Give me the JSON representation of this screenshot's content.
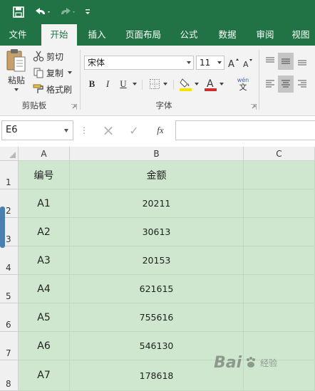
{
  "colors": {
    "accent": "#217346",
    "selection_fill": "#cfe7cf",
    "font_color_bar": "#d42b2b",
    "fill_color_bar": "#f5e400"
  },
  "qat": {
    "icons": [
      "save-icon",
      "undo-icon",
      "redo-icon",
      "customize-qat-icon"
    ]
  },
  "tabs": [
    {
      "label": "文件",
      "active": false
    },
    {
      "label": "开始",
      "active": true
    },
    {
      "label": "插入",
      "active": false
    },
    {
      "label": "页面布局",
      "active": false
    },
    {
      "label": "公式",
      "active": false
    },
    {
      "label": "数据",
      "active": false
    },
    {
      "label": "审阅",
      "active": false
    },
    {
      "label": "视图",
      "active": false
    }
  ],
  "clipboard": {
    "paste": "粘贴",
    "cut": "剪切",
    "copy": "复制",
    "format_painter": "格式刷",
    "group_label": "剪贴板"
  },
  "font": {
    "name": "宋体",
    "size": "11",
    "bold": "B",
    "italic": "I",
    "underline": "U",
    "font_color_letter": "A",
    "phonetic_top": "wén",
    "phonetic_bottom": "文",
    "group_label": "字体"
  },
  "formula_bar": {
    "name_box": "E6",
    "cancel_icon": "×",
    "enter_icon": "✓",
    "fx": "fx",
    "value": ""
  },
  "columns": [
    "A",
    "B",
    "C"
  ],
  "rows": [
    {
      "num": "1",
      "a": "编号",
      "b": "金额"
    },
    {
      "num": "2",
      "a": "A1",
      "b": "20211"
    },
    {
      "num": "3",
      "a": "A2",
      "b": "30613"
    },
    {
      "num": "4",
      "a": "A3",
      "b": "20153"
    },
    {
      "num": "5",
      "a": "A4",
      "b": "621615"
    },
    {
      "num": "6",
      "a": "A5",
      "b": "755616"
    },
    {
      "num": "7",
      "a": "A6",
      "b": "546130"
    },
    {
      "num": "8",
      "a": "A7",
      "b": "178618"
    }
  ],
  "watermark": {
    "brand": "Bai",
    "tail": "百度",
    "sub": "经验"
  }
}
